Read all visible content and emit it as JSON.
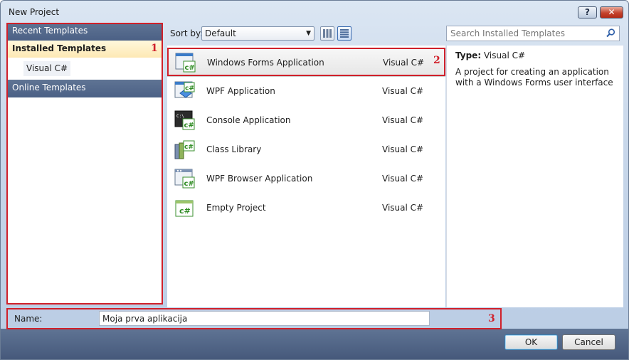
{
  "window": {
    "title": "New Project",
    "help_label": "?",
    "close_label": "✕"
  },
  "categories": {
    "recent": "Recent Templates",
    "installed": "Installed Templates",
    "sub": "Visual C#",
    "online": "Online Templates"
  },
  "toolbar": {
    "sort_label": "Sort by:",
    "sort_value": "Default",
    "search_placeholder": "Search Installed Templates"
  },
  "templates": [
    {
      "name": "Windows Forms Application",
      "lang": "Visual C#",
      "icon": "windows-forms-icon",
      "selected": true
    },
    {
      "name": "WPF Application",
      "lang": "Visual C#",
      "icon": "wpf-icon"
    },
    {
      "name": "Console Application",
      "lang": "Visual C#",
      "icon": "console-icon"
    },
    {
      "name": "Class Library",
      "lang": "Visual C#",
      "icon": "class-library-icon"
    },
    {
      "name": "WPF Browser Application",
      "lang": "Visual C#",
      "icon": "wpf-browser-icon"
    },
    {
      "name": "Empty Project",
      "lang": "Visual C#",
      "icon": "empty-project-icon"
    }
  ],
  "description": {
    "type_label": "Type:",
    "type_value": "Visual C#",
    "text": "A project for creating an application with a Windows Forms user interface"
  },
  "name_field": {
    "label": "Name:",
    "value": "Moja prva aplikacija"
  },
  "buttons": {
    "ok": "OK",
    "cancel": "Cancel"
  },
  "annotations": [
    "1",
    "2",
    "3"
  ],
  "colors": {
    "annotation": "#d0202a",
    "header": "#4b6085",
    "selected_category": "#fde8b4"
  }
}
